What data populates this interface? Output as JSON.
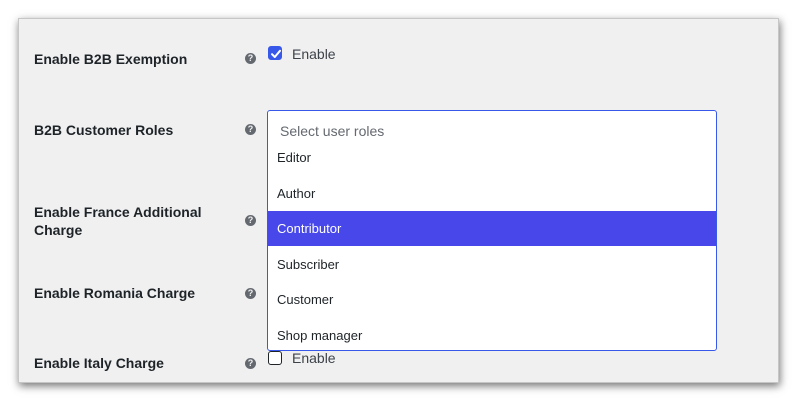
{
  "settings": {
    "b2b_exemption": {
      "label": "Enable B2B Exemption",
      "help": "?",
      "checkbox_label": "Enable",
      "checked": true
    },
    "customer_roles": {
      "label": "B2B Customer Roles",
      "help": "?",
      "placeholder": "Select user roles",
      "options": [
        "Editor",
        "Author",
        "Contributor",
        "Subscriber",
        "Customer",
        "Shop manager"
      ],
      "highlighted": "Contributor"
    },
    "france": {
      "label": "Enable France Additional Charge",
      "help": "?"
    },
    "romania": {
      "label": "Enable Romania Charge",
      "help": "?"
    },
    "italy": {
      "label": "Enable Italy Charge",
      "help": "?",
      "checkbox_label": "Enable",
      "checked": false
    }
  },
  "colors": {
    "accent": "#3858e9",
    "highlight": "#4848ea",
    "panel": "#f0f0f1"
  }
}
